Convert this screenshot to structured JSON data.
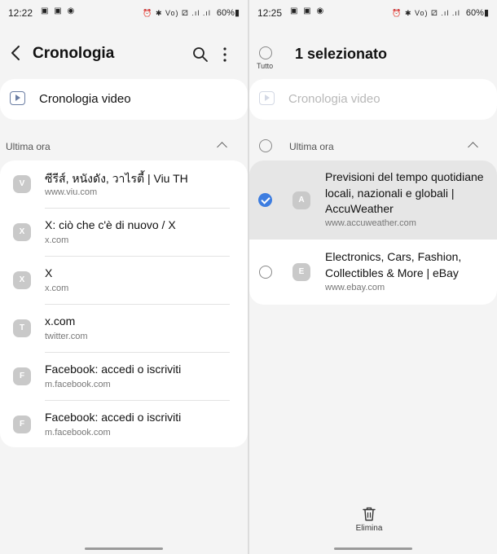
{
  "left": {
    "status": {
      "time": "12:22",
      "left_icons": "▣ ▣ ◉",
      "right_symbols": "⏰ ✱ Vo) ⚂ .ıl .ıl",
      "battery": "60%▮"
    },
    "header": {
      "title": "Cronologia"
    },
    "video_history": {
      "label": "Cronologia video"
    },
    "section": {
      "label": "Ultima ora"
    },
    "items": [
      {
        "avatar": "V",
        "title": "ซีรีส์, หนังดัง, วาไรตี้ | Viu TH",
        "url": "www.viu.com"
      },
      {
        "avatar": "X",
        "title": "X: ciò che c'è di nuovo / X",
        "url": "x.com"
      },
      {
        "avatar": "X",
        "title": "X",
        "url": "x.com"
      },
      {
        "avatar": "T",
        "title": "x.com",
        "url": "twitter.com"
      },
      {
        "avatar": "F",
        "title": "Facebook: accedi o iscriviti",
        "url": "m.facebook.com"
      },
      {
        "avatar": "F",
        "title": "Facebook: accedi o iscriviti",
        "url": "m.facebook.com"
      }
    ]
  },
  "right": {
    "status": {
      "time": "12:25",
      "left_icons": "▣ ▣ ◉",
      "right_symbols": "⏰ ✱ Vo) ⚂ .ıl .ıl",
      "battery": "60%▮"
    },
    "select_all_label": "Tutto",
    "header": {
      "title": "1 selezionato"
    },
    "video_history": {
      "label": "Cronologia video"
    },
    "section": {
      "label": "Ultima ora"
    },
    "items": [
      {
        "avatar": "A",
        "title": "Previsioni del tempo quotidiane locali, nazionali e globali | AccuWeather",
        "url": "www.accuweather.com",
        "selected": true
      },
      {
        "avatar": "E",
        "title": "Electronics, Cars, Fashion, Collectibles & More | eBay",
        "url": "www.ebay.com",
        "selected": false
      }
    ],
    "delete_label": "Elimina"
  },
  "colors": {
    "accent": "#3d7de0",
    "selected_row": "#e6e6e6",
    "avatar": "#c9c9c9"
  }
}
